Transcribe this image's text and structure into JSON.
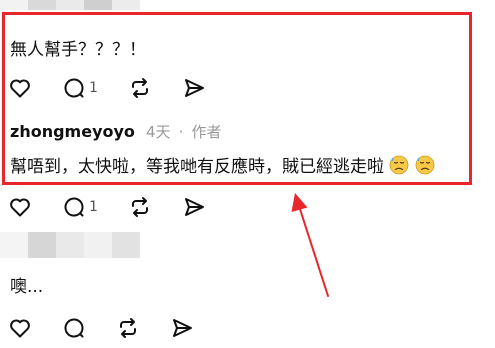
{
  "comment_top": {
    "text": "無人幫手？？？！",
    "actions": {
      "reply_count": "1"
    }
  },
  "reply": {
    "username": "zhongmeyoyo",
    "time": "4天",
    "separator": "·",
    "role": "作者",
    "text": "幫唔到，太快啦，等我哋有反應時，賊已經逃走啦",
    "emoji": [
      "downcast-face-with-sweat-icon",
      "downcast-face-with-sweat-icon"
    ],
    "actions": {
      "reply_count": "1"
    }
  },
  "comment_bottom": {
    "text": "噢...",
    "actions": {}
  },
  "colors": {
    "highlight": "#e8262b",
    "arrow": "#e8262b",
    "meta": "#999999"
  }
}
